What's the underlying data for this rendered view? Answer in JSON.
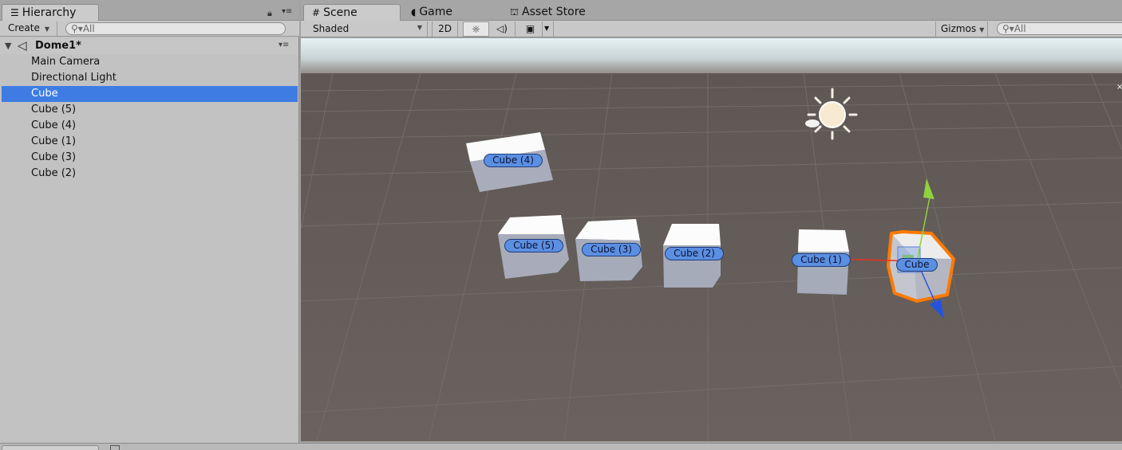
{
  "hierarchy": {
    "tab_label": "Hierarchy",
    "create_label": "Create",
    "search_placeholder": "All",
    "scene_name": "Dome1*",
    "items": [
      {
        "label": "Main Camera",
        "selected": false
      },
      {
        "label": "Directional Light",
        "selected": false
      },
      {
        "label": "Cube",
        "selected": true
      },
      {
        "label": "Cube (5)",
        "selected": false
      },
      {
        "label": "Cube (4)",
        "selected": false
      },
      {
        "label": "Cube (1)",
        "selected": false
      },
      {
        "label": "Cube (3)",
        "selected": false
      },
      {
        "label": "Cube (2)",
        "selected": false
      }
    ]
  },
  "scene_tabs": {
    "scene": "Scene",
    "game": "Game",
    "asset_store": "Asset Store"
  },
  "scene_toolbar": {
    "draw_mode": "Shaded",
    "mode_2d": "2D",
    "gizmos": "Gizmos",
    "search_placeholder": "All"
  },
  "viewport": {
    "labels": {
      "cube4": "Cube (4)",
      "cube5": "Cube (5)",
      "cube3": "Cube (3)",
      "cube2": "Cube (2)",
      "cube1": "Cube (1)",
      "cube": "Cube"
    }
  },
  "colors": {
    "selection": "#3e7ce4",
    "ground": "#665e5a",
    "sky": "#e2ecee",
    "cube_label": "#5b8fe2",
    "selection_outline": "#ff7a00",
    "gizmo_x": "#e8321e",
    "gizmo_y": "#8fd23a",
    "gizmo_z": "#2453e0"
  }
}
